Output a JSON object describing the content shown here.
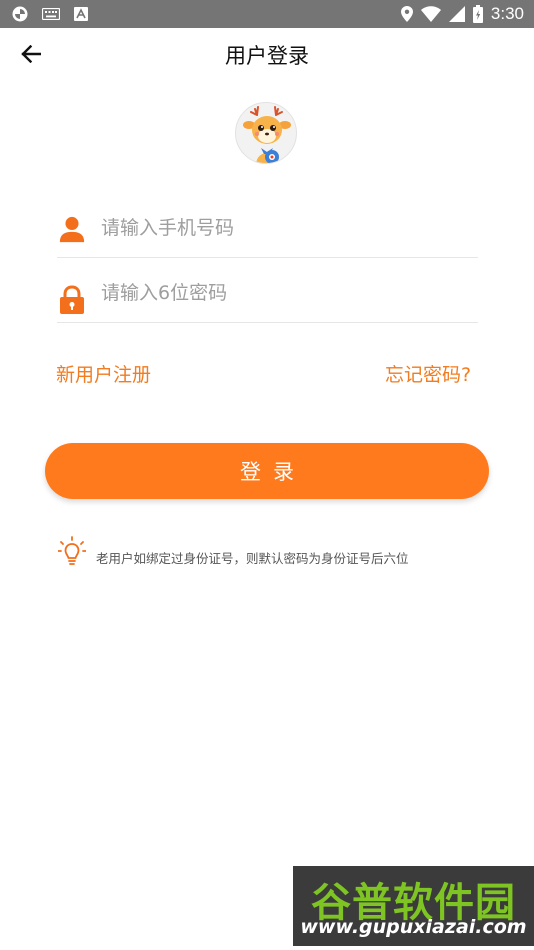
{
  "status_bar": {
    "time": "3:30",
    "left_icons": [
      "app-indicator-icon",
      "keyboard-icon",
      "text-input-icon"
    ],
    "right_icons": [
      "location-icon",
      "wifi-icon",
      "signal-icon",
      "battery-icon"
    ]
  },
  "header": {
    "title": "用户登录",
    "back_icon": "arrow-left-icon"
  },
  "avatar": {
    "icon": "deer-mascot-icon"
  },
  "form": {
    "phone_placeholder": "请输入手机号码",
    "password_placeholder": "请输入6位密码",
    "phone_value": "",
    "password_value": "",
    "phone_icon": "person-icon",
    "password_icon": "lock-icon"
  },
  "links": {
    "register": "新用户注册",
    "forgot": "忘记密码?"
  },
  "login_button": "登录",
  "tip": {
    "icon": "lightbulb-icon",
    "text": "老用户如绑定过身份证号，则默认密码为身份证号后六位"
  },
  "watermark": {
    "title": "谷普软件园",
    "url": "www.gupuxiazai.com"
  },
  "colors": {
    "accent": "#ff7a1c",
    "link": "#f27c1f",
    "status_bar": "#757575"
  }
}
